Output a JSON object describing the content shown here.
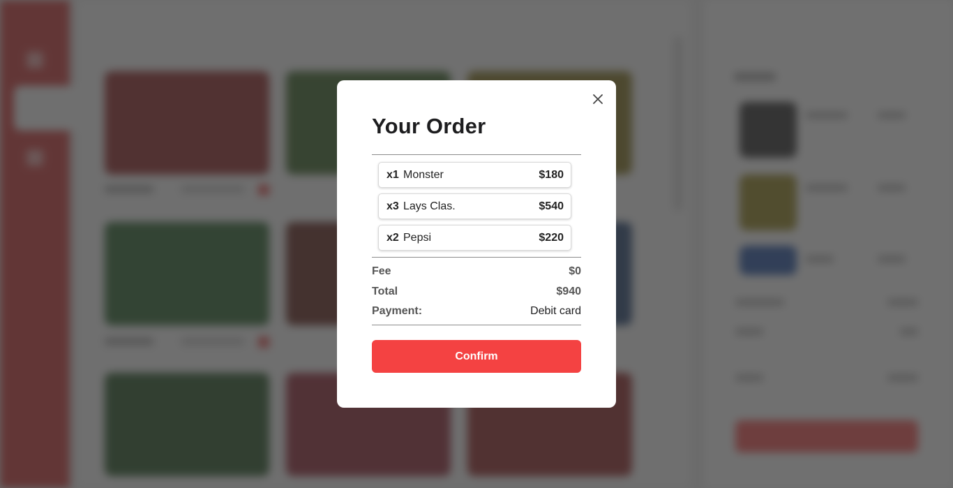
{
  "modal": {
    "title": "Your Order",
    "items": [
      {
        "qty": "x1",
        "name": "Monster",
        "price": "$180"
      },
      {
        "qty": "x3",
        "name": "Lays Clas.",
        "price": "$540"
      },
      {
        "qty": "x2",
        "name": "Pepsi",
        "price": "$220"
      }
    ],
    "fee_label": "Fee",
    "fee_value": "$0",
    "total_label": "Total",
    "total_value": "$940",
    "payment_label": "Payment:",
    "payment_value": "Debit card",
    "confirm_label": "Confirm",
    "close_icon": "close-icon"
  },
  "colors": {
    "accent": "#f44242",
    "sidebar": "#c72a2a",
    "overlay": "rgba(60,60,60,0.72)"
  }
}
